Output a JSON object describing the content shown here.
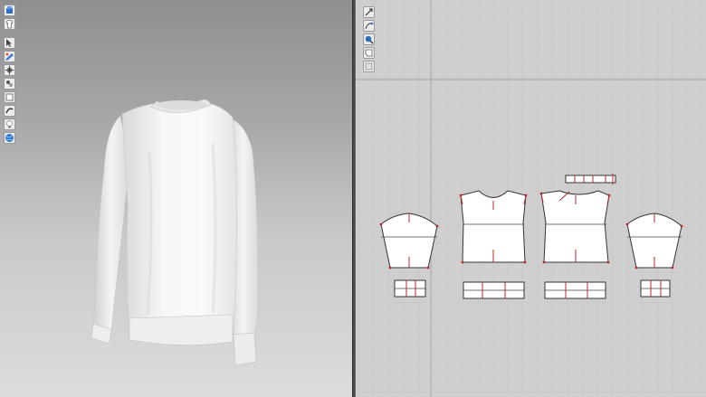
{
  "window": {
    "title": ""
  },
  "viewport_3d": {
    "toolbar_icons": [
      "avatar-icon",
      "garment-icon",
      "pointer-icon",
      "texture-icon",
      "transform-icon",
      "fit-icon",
      "layer-icon",
      "strengthen-icon",
      "lighting-icon",
      "globe-icon"
    ],
    "garment": {
      "name": "",
      "type": "long-sleeve sweatshirt",
      "color": "#f2f2f2"
    },
    "background": {
      "top": "#8f8f92",
      "bottom": "#dcdcde"
    }
  },
  "viewport_2d": {
    "toolbar_icons": [
      "select-icon",
      "edit-curve-icon",
      "zoom-icon",
      "piece-icon",
      "texture-piece-icon"
    ],
    "pattern_pieces": [
      "sleeve-left",
      "front-body",
      "back-body",
      "sleeve-right",
      "neck-band",
      "cuff-left",
      "hem-band-front",
      "hem-band-back",
      "cuff-right"
    ],
    "colors": {
      "background": "#cfcfcf",
      "grid_minor": "#bdbdbd",
      "grid_major": "#a9a9a9",
      "seam": "#b72b2b",
      "piece_fill": "#ffffff",
      "outline": "#333333"
    }
  }
}
